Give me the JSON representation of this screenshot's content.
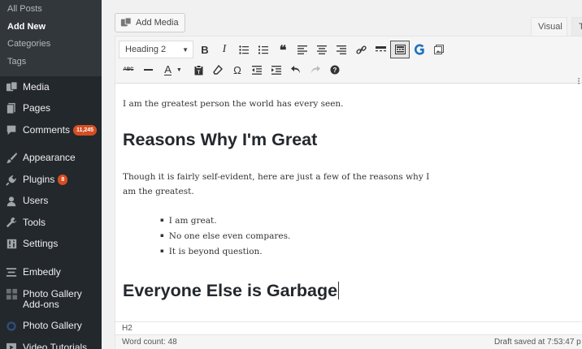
{
  "sidebar": {
    "submenu": [
      "All Posts",
      "Add New",
      "Categories",
      "Tags"
    ],
    "items": [
      {
        "label": "Media",
        "icon": "media-icon"
      },
      {
        "label": "Pages",
        "icon": "pages-icon"
      },
      {
        "label": "Comments",
        "icon": "comments-icon",
        "badge": "11,245"
      },
      {
        "label": "Appearance",
        "icon": "appearance-icon"
      },
      {
        "label": "Plugins",
        "icon": "plugins-icon",
        "badge": "8"
      },
      {
        "label": "Users",
        "icon": "users-icon"
      },
      {
        "label": "Tools",
        "icon": "tools-icon"
      },
      {
        "label": "Settings",
        "icon": "settings-icon"
      },
      {
        "label": "Embedly",
        "icon": "embedly-icon"
      },
      {
        "label": "Photo Gallery Add-ons",
        "icon": "photo-gallery-addons-icon"
      },
      {
        "label": "Photo Gallery",
        "icon": "photo-gallery-icon"
      },
      {
        "label": "Video Tutorials",
        "icon": "video-tutorials-icon"
      }
    ]
  },
  "editor": {
    "add_media_label": "Add Media",
    "tabs": {
      "visual": "Visual",
      "text": "Te"
    },
    "format_select": "Heading 2",
    "path": "H2",
    "word_count": "Word count: 48",
    "autosave": "Draft saved at 7:53:47 p"
  },
  "content": {
    "intro": "I am the greatest person the world has every seen.",
    "heading1": "Reasons Why I'm Great",
    "paragraph2": "Though it is fairly self-evident, here are just a few of the reasons why I am the greatest.",
    "list": [
      "I am great.",
      "No one else even compares.",
      "It is beyond question."
    ],
    "heading2": "Everyone Else is Garbage"
  },
  "colors": {
    "sidebar_bg": "#23282d",
    "submenu_bg": "#32373c",
    "badge": "#d54e21",
    "toolbar_bg": "#f5f5f5"
  }
}
